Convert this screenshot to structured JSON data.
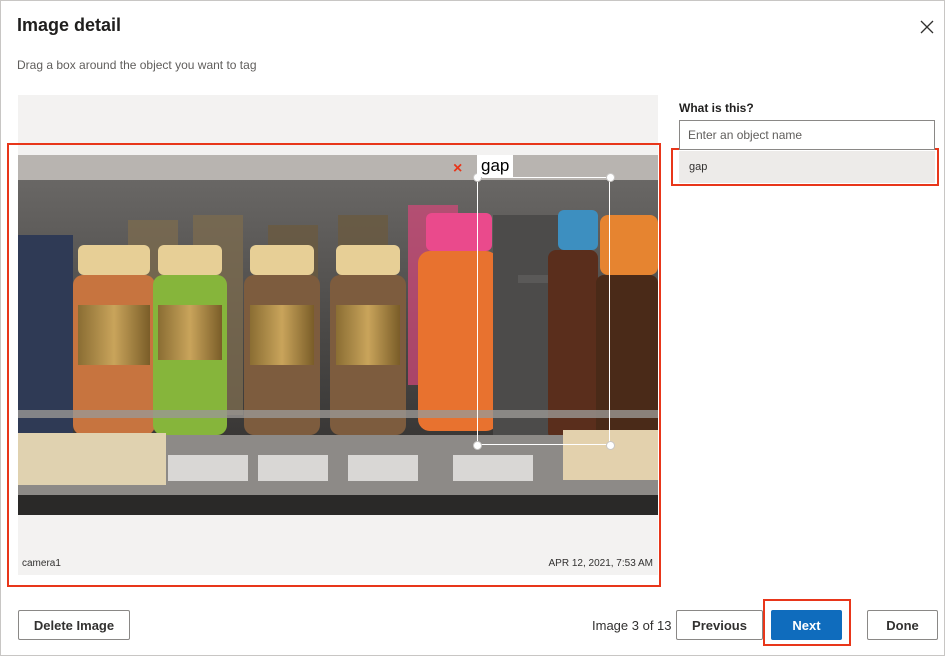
{
  "dialog": {
    "title": "Image detail",
    "subtitle": "Drag a box around the object you want to tag",
    "close_icon": "close-icon"
  },
  "image": {
    "camera": "camera1",
    "timestamp": "APR 12, 2021, 7:53 AM",
    "region": {
      "tag": "gap",
      "remove_icon": "close-icon"
    }
  },
  "side_panel": {
    "question": "What is this?",
    "input_placeholder": "Enter an object name",
    "input_value": "",
    "suggestions": [
      "gap"
    ]
  },
  "footer": {
    "delete_label": "Delete Image",
    "pager_text": "Image 3 of 13",
    "previous_label": "Previous",
    "next_label": "Next",
    "done_label": "Done"
  },
  "colors": {
    "accent": "#0f6cbd",
    "highlight": "#e8361a"
  }
}
